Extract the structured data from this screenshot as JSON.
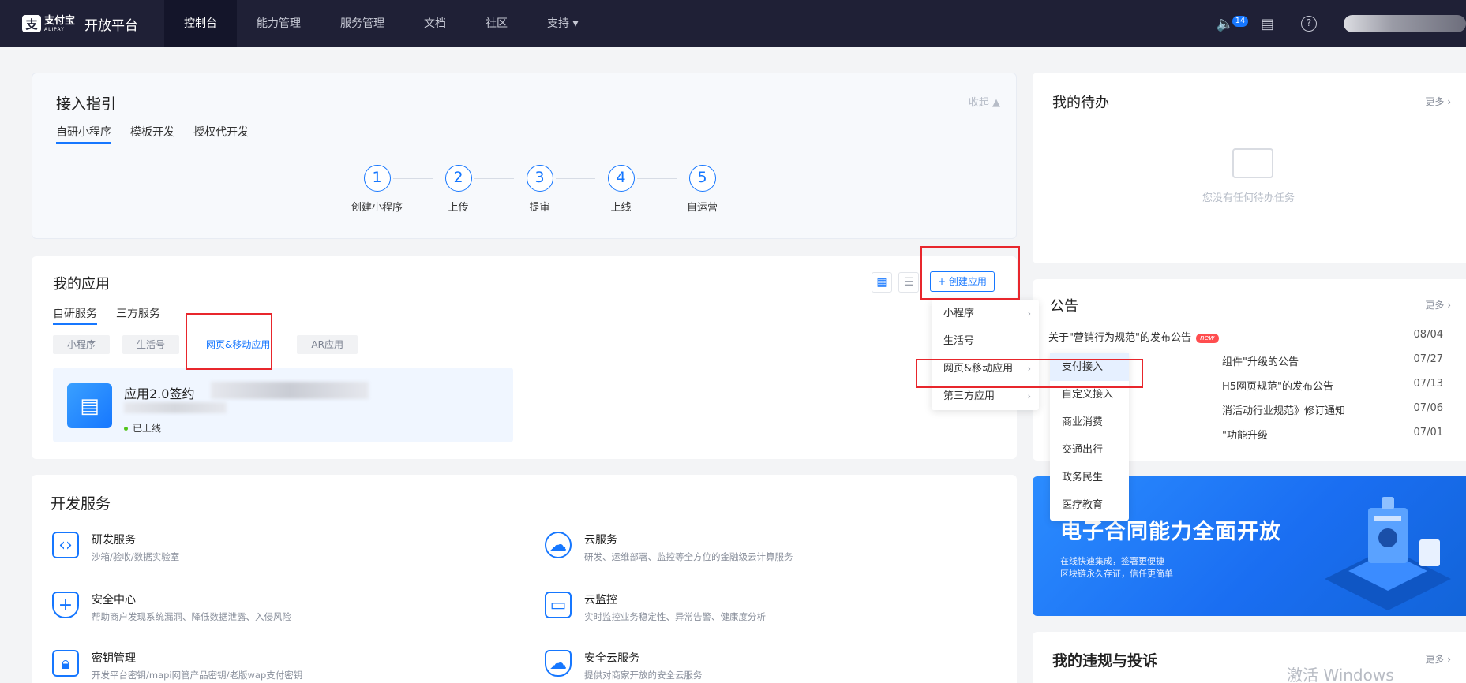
{
  "header": {
    "logo_cn": "支付宝",
    "logo_en": "ALIPAY",
    "brand": "开放平台",
    "nav": [
      "控制台",
      "能力管理",
      "服务管理",
      "文档",
      "社区",
      "支持 ▾"
    ],
    "badge": "14"
  },
  "guide": {
    "title": "接入指引",
    "collapse": "收起 ▲",
    "tabs": [
      "自研小程序",
      "模板开发",
      "授权代开发"
    ],
    "steps": [
      {
        "num": "1",
        "label": "创建小程序"
      },
      {
        "num": "2",
        "label": "上传"
      },
      {
        "num": "3",
        "label": "提审"
      },
      {
        "num": "4",
        "label": "上线"
      },
      {
        "num": "5",
        "label": "自运营"
      }
    ]
  },
  "apps": {
    "title": "我的应用",
    "tabs": [
      "自研服务",
      "三方服务"
    ],
    "filters": [
      "小程序",
      "生活号",
      "网页&移动应用",
      "AR应用"
    ],
    "create_button": "+ 创建应用",
    "app_name": "应用2.0签约",
    "app_status": "已上线"
  },
  "create_menu": {
    "items": [
      "小程序",
      "生活号",
      "网页&移动应用",
      "第三方应用"
    ],
    "submenu": [
      "支付接入",
      "自定义接入",
      "商业消费",
      "交通出行",
      "政务民生",
      "医疗教育"
    ]
  },
  "dev": {
    "title": "开发服务",
    "services": [
      {
        "name": "研发服务",
        "desc": "沙箱/验收/数据实验室",
        "icon": "code-icon"
      },
      {
        "name": "云服务",
        "desc": "研发、运维部署、监控等全方位的金融级云计算服务",
        "icon": "cloud-icon"
      },
      {
        "name": "安全中心",
        "desc": "帮助商户发现系统漏洞、降低数据泄露、入侵风险",
        "icon": "shield-plus-icon"
      },
      {
        "name": "云监控",
        "desc": "实时监控业务稳定性、异常告警、健康度分析",
        "icon": "monitor-icon"
      },
      {
        "name": "密钥管理",
        "desc": "开发平台密钥/mapi网管产品密钥/老版wap支付密钥",
        "icon": "lock-icon"
      },
      {
        "name": "安全云服务",
        "desc": "提供对商家开放的安全云服务",
        "icon": "shield-cloud-icon"
      }
    ]
  },
  "todo": {
    "title": "我的待办",
    "more": "更多 ›",
    "empty": "您没有任何待办任务"
  },
  "notice": {
    "title": "公告",
    "more": "更多 ›",
    "new": "new",
    "rows": [
      {
        "text": "关于\"营销行为规范\"的发布公告",
        "date": "08/04"
      },
      {
        "text": "组件\"升级的公告",
        "date": "07/27"
      },
      {
        "text": "H5网页规范\"的发布公告",
        "date": "07/13"
      },
      {
        "text": "消活动行业规范》修订通知",
        "date": "07/06"
      },
      {
        "text": "\"功能升级",
        "date": "07/01"
      }
    ]
  },
  "banner": {
    "title": "电子合同能力全面开放",
    "line1": "在线快速集成，签署更便捷",
    "line2": "区块链永久存证，信任更简单"
  },
  "complaint": {
    "title": "我的违规与投诉",
    "more": "更多 ›"
  },
  "watermark": "激活 Windows",
  "colors": {
    "accent": "#1677ff",
    "nav_bg": "#1f2036",
    "annotation": "#e8262c"
  }
}
